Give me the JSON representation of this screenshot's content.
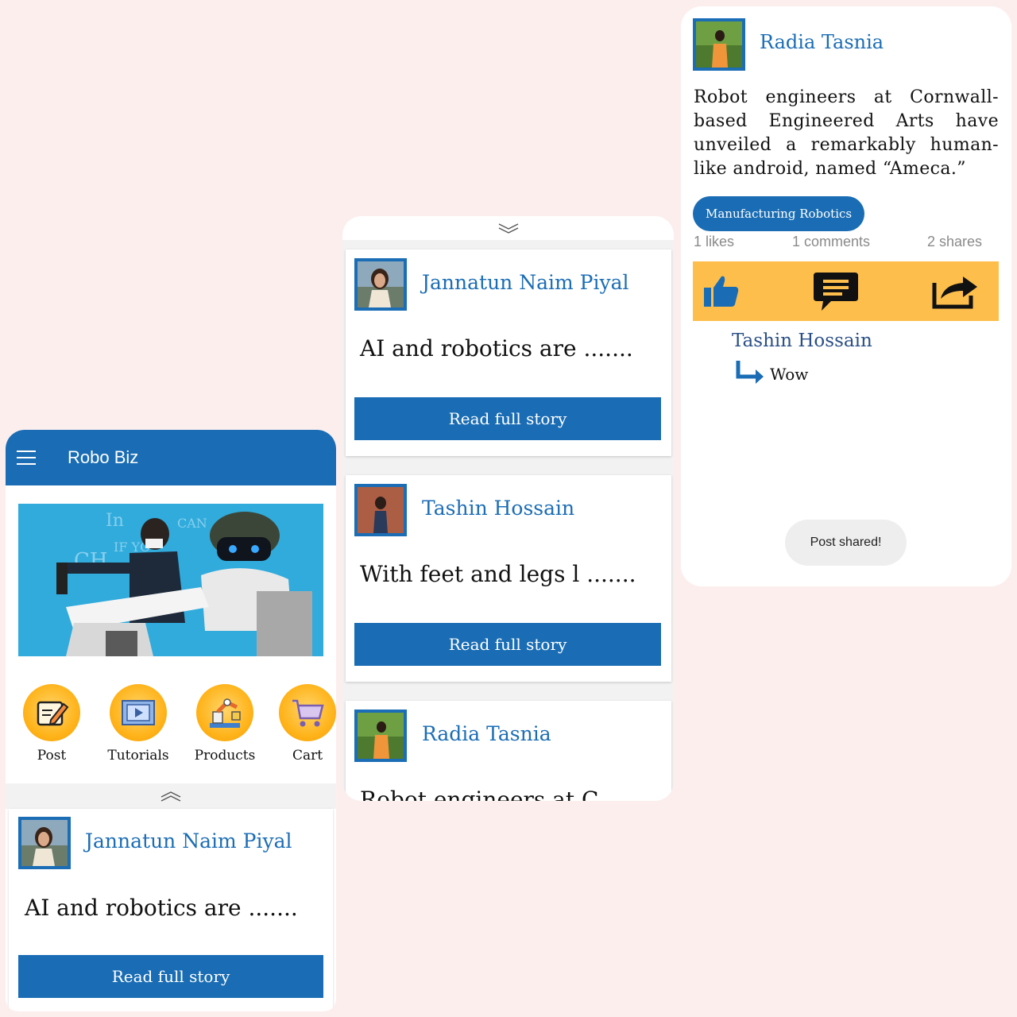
{
  "app": {
    "title": "Robo Biz"
  },
  "quick_actions": [
    {
      "label": "Post",
      "icon": "edit-post-icon"
    },
    {
      "label": "Tutorials",
      "icon": "video-tutorial-icon"
    },
    {
      "label": "Products",
      "icon": "robot-arm-icon"
    },
    {
      "label": "Cart",
      "icon": "shopping-cart-icon"
    }
  ],
  "feed_left": [
    {
      "author": "Jannatun Naim Piyal",
      "excerpt": "AI and robotics are  .......",
      "button": "Read full story"
    }
  ],
  "feed_middle": [
    {
      "author": "Jannatun Naim Piyal",
      "excerpt": "AI and robotics are  .......",
      "button": "Read full story"
    },
    {
      "author": "Tashin Hossain",
      "excerpt": "With feet and legs l .......",
      "button": "Read full story"
    },
    {
      "author": "Radia Tasnia",
      "excerpt": "Robot engineers at C"
    }
  ],
  "post_detail": {
    "author": "Radia Tasnia",
    "body": "Robot engineers at Cornwall-based Engineered Arts have unveiled a remarkably human-like android, named “Ameca.”",
    "tag": "Manufacturing Robotics",
    "likes": "1 likes",
    "comments": "1 comments",
    "shares": "2 shares",
    "comment": {
      "author": "Tashin Hossain",
      "text": "Wow"
    },
    "toast": "Post shared!"
  },
  "colors": {
    "primary": "#1a6db4",
    "accent": "#fdbe4c",
    "background": "#fdeeee"
  }
}
